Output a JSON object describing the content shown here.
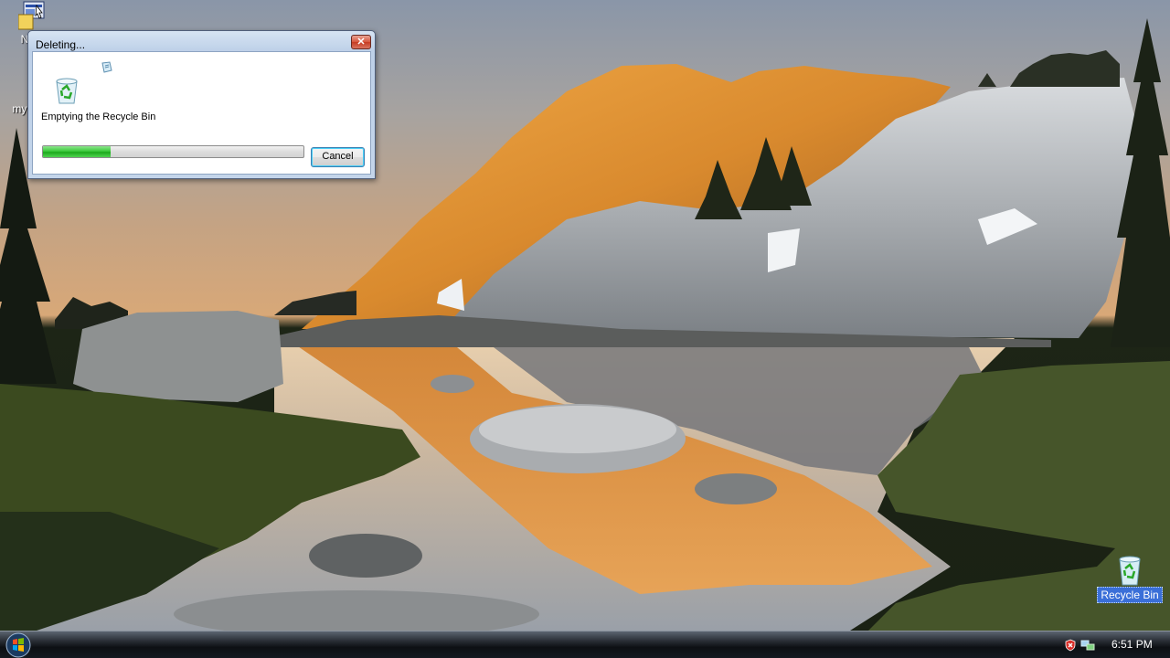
{
  "desktop": {
    "icons": [
      {
        "label": "NetP"
      },
      {
        "label": "mypa"
      },
      {
        "label": "Recycle Bin"
      }
    ]
  },
  "dialog": {
    "title": "Deleting...",
    "close_glyph": "✕",
    "status_text": "Emptying the Recycle Bin",
    "progress_percent": 26,
    "cancel_label": "Cancel"
  },
  "taskbar": {
    "clock": "6:51 PM",
    "tray_icons": [
      "security-alert-icon",
      "network-icon"
    ]
  },
  "colors": {
    "progress": "#2ebd2e",
    "title_close": "#c53b22",
    "selection": "#3a6fd8"
  }
}
